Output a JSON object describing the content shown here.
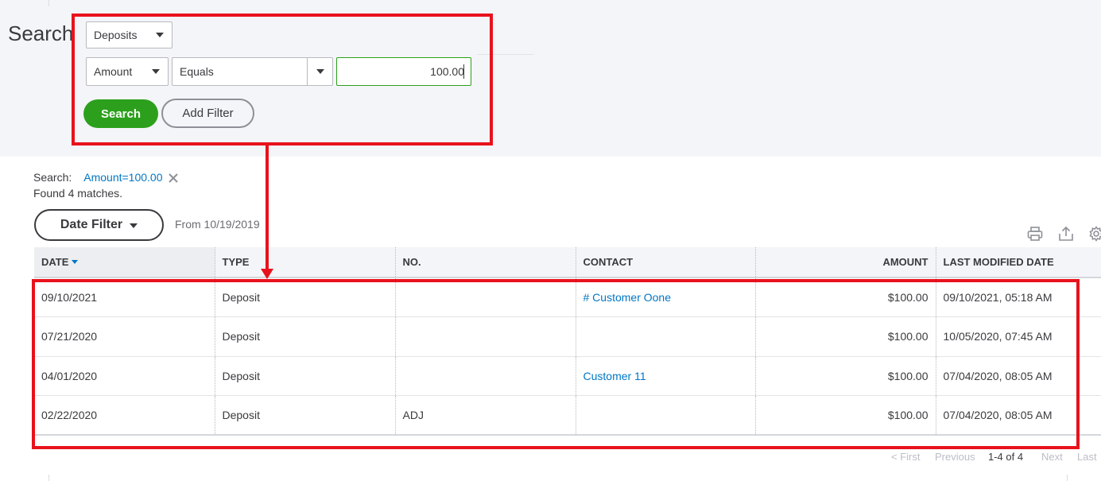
{
  "page": {
    "title": "Search"
  },
  "filters": {
    "transaction_type": "Deposits",
    "field": "Amount",
    "operator": "Equals",
    "value": "100.00"
  },
  "actions": {
    "search_label": "Search",
    "add_filter_label": "Add Filter"
  },
  "summary": {
    "search_label": "Search:",
    "active_filter": "Amount=100.00",
    "found_text": "Found 4 matches."
  },
  "date_filter": {
    "label": "Date Filter",
    "from_text": "From 10/19/2019"
  },
  "toolbar": {
    "icons": [
      "print-icon",
      "export-icon",
      "settings-icon"
    ]
  },
  "table": {
    "columns": [
      "DATE",
      "TYPE",
      "NO.",
      "CONTACT",
      "AMOUNT",
      "LAST MODIFIED DATE"
    ],
    "rows": [
      {
        "date": "09/10/2021",
        "type": "Deposit",
        "no": "",
        "contact": "# Customer Oone",
        "amount": "$100.00",
        "modified": "09/10/2021, 05:18 AM"
      },
      {
        "date": "07/21/2020",
        "type": "Deposit",
        "no": "",
        "contact": "",
        "amount": "$100.00",
        "modified": "10/05/2020, 07:45 AM"
      },
      {
        "date": "04/01/2020",
        "type": "Deposit",
        "no": "",
        "contact": "Customer 11",
        "amount": "$100.00",
        "modified": "07/04/2020, 08:05 AM"
      },
      {
        "date": "02/22/2020",
        "type": "Deposit",
        "no": "ADJ",
        "contact": "",
        "amount": "$100.00",
        "modified": "07/04/2020, 08:05 AM"
      }
    ]
  },
  "pagination": {
    "first": "< First",
    "previous": "Previous",
    "range": "1-4 of 4",
    "next": "Next",
    "last": "Last"
  },
  "colors": {
    "accent_green": "#2ca01c",
    "link_blue": "#0077c5",
    "annotation_red": "#e8121c",
    "panel_gray": "#f4f5f8"
  }
}
